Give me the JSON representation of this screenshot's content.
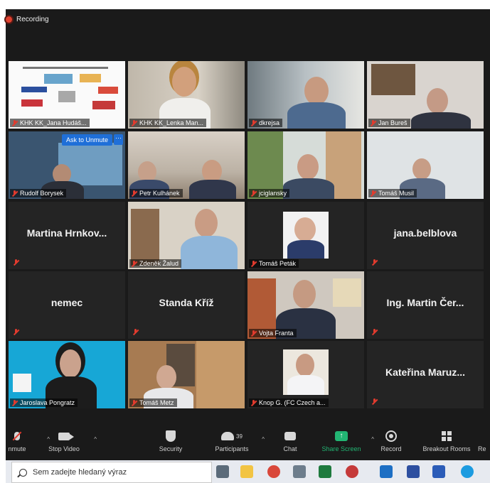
{
  "recording": {
    "label": "Recording"
  },
  "tiles": [
    {
      "label": "KHK KK_Jana Hudáš..."
    },
    {
      "label": "KHK KK_Lenka Man..."
    },
    {
      "label": "dkrejsa"
    },
    {
      "label": "Jan Bureš"
    },
    {
      "label": "Rudolf Borysek"
    },
    {
      "label": "Petr Kulhánek"
    },
    {
      "label": "jciglansky"
    },
    {
      "label": "Tomáš Musil"
    },
    {
      "label": "",
      "name": "Martina Hrnkov..."
    },
    {
      "label": "Zdeněk Žalud"
    },
    {
      "label": "Tomáš Peták"
    },
    {
      "label": "",
      "name": "jana.belblova"
    },
    {
      "label": "",
      "name": "nemec"
    },
    {
      "label": "",
      "name": "Standa Kříž"
    },
    {
      "label": "Vojta Franta"
    },
    {
      "label": "",
      "name": "Ing. Martin Čer..."
    },
    {
      "label": "Jaroslava Pongratz"
    },
    {
      "label": "Tomáš Metz"
    },
    {
      "label": "Knop G. (FC Czech a..."
    },
    {
      "label": "",
      "name": "Kateřina Maruz..."
    }
  ],
  "ask_to_unmute": "Ask to Unmute",
  "more_dots": "···",
  "toolbar": {
    "unmute": "nmute",
    "stop_video": "Stop Video",
    "security": "Security",
    "participants": "Participants",
    "participants_count": "39",
    "chat": "Chat",
    "share_screen": "Share Screen",
    "record": "Record",
    "breakout_rooms": "Breakout Rooms",
    "reactions_cut": "Re",
    "share_color": "#22b573"
  },
  "taskbar": {
    "search_placeholder": "Sem zadejte hledaný výraz"
  }
}
